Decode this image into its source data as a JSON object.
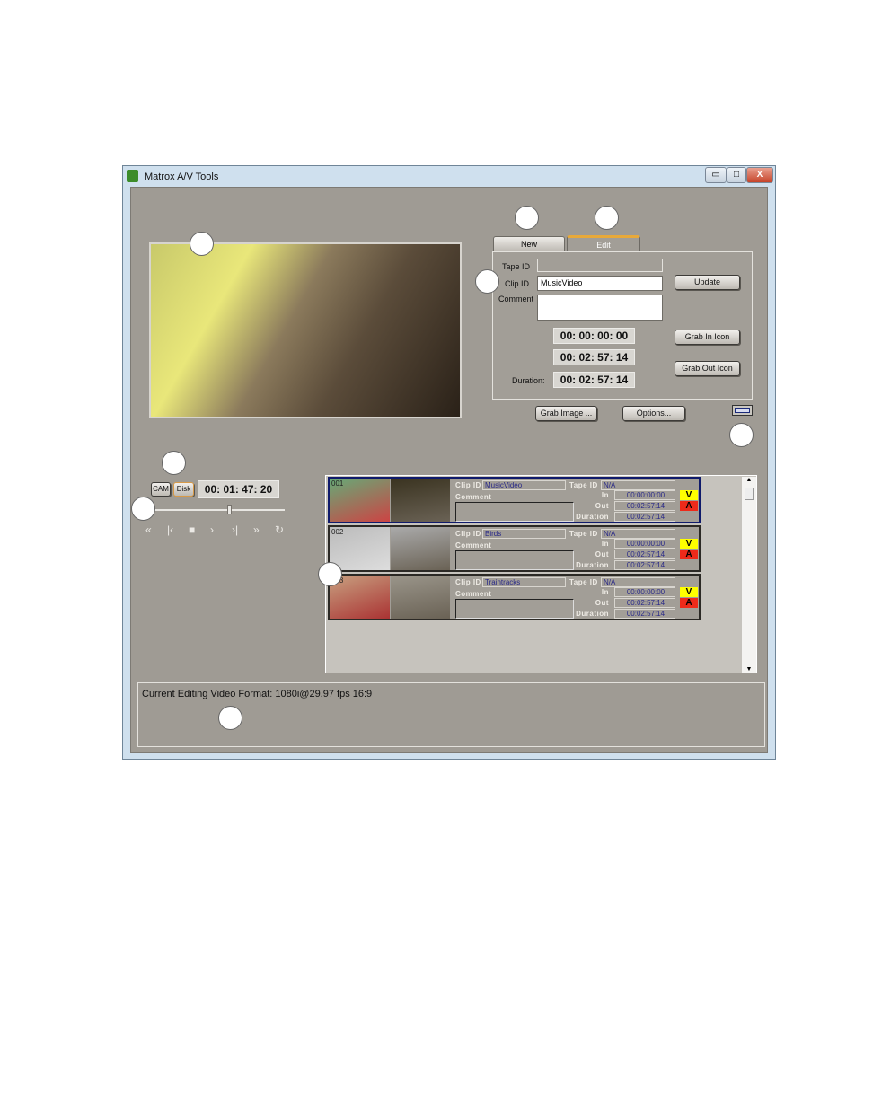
{
  "window": {
    "title": "Matrox A/V Tools",
    "min": "▭",
    "max": "□",
    "close": "X"
  },
  "tabs": [
    {
      "label": "New"
    },
    {
      "label": "Edit"
    }
  ],
  "edit": {
    "tape_id_label": "Tape ID",
    "tape_id": "",
    "clip_id_label": "Clip ID",
    "clip_id": "MusicVideo",
    "comment_label": "Comment",
    "comment": "",
    "in": "00: 00: 00: 00",
    "out": "00: 02: 57: 14",
    "duration_label": "Duration:",
    "duration": "00: 02: 57: 14",
    "update": "Update",
    "grab_in": "Grab In Icon",
    "grab_out": "Grab Out Icon"
  },
  "buttons": {
    "grab_image": "Grab Image ...",
    "options": "Options..."
  },
  "transport": {
    "cam": "CAM",
    "disk": "Disk",
    "timecode": "00: 01: 47: 20",
    "position": 0.58,
    "icons": [
      "«",
      "|‹",
      "■",
      "›",
      "›|",
      "»",
      "↻"
    ]
  },
  "clips": [
    {
      "num": "001",
      "clip_id": "MusicVideo",
      "tape_id": "N/A",
      "comment": "",
      "in": "00:00:00:00",
      "out": "00:02:57:14",
      "duration": "00:02:57:14",
      "selected": true
    },
    {
      "num": "002",
      "clip_id": "Birds",
      "tape_id": "N/A",
      "comment": "",
      "in": "00:00:00:00",
      "out": "00:02:57:14",
      "duration": "00:02:57:14",
      "selected": false
    },
    {
      "num": "003",
      "clip_id": "Traintracks",
      "tape_id": "N/A",
      "comment": "",
      "in": "00:00:00:00",
      "out": "00:02:57:14",
      "duration": "00:02:57:14",
      "selected": false
    }
  ],
  "clip_labels": {
    "clip_id": "Clip ID",
    "tape_id": "Tape ID",
    "comment": "Comment",
    "in": "In",
    "out": "Out",
    "duration": "Duration",
    "v": "V",
    "a": "A"
  },
  "status": {
    "text": "Current Editing Video Format: 1080i@29.97 fps 16:9"
  }
}
